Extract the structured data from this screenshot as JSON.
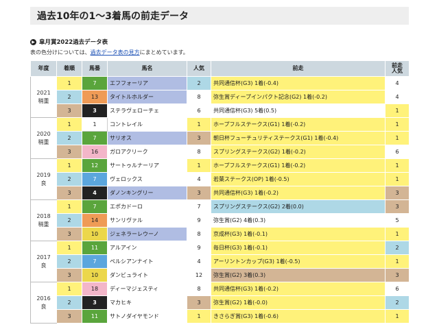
{
  "page_title": "過去10年の1〜3着馬の前走データ",
  "section_title": "皐月賞2022過去データ表",
  "note_prefix": "表の色分けについては、",
  "note_link": "過去データ表の見方",
  "note_suffix": "にまとめています。",
  "headers": {
    "year": "年度",
    "rank": "着順",
    "gate": "馬番",
    "name": "馬名",
    "pop": "人気",
    "prev": "前走",
    "prevpop_line1": "前走",
    "prevpop_line2": "人気"
  },
  "groups": [
    {
      "year": "2021",
      "track": "稍重",
      "rows": [
        {
          "rank": "1",
          "gate": "7",
          "name": "エフフォーリア",
          "pop": "2",
          "prev": "共同通信杯(G3) 1着(-0.4)",
          "prevpop": "4",
          "c": {
            "rank": "y",
            "gate": "g6",
            "name": "l",
            "pop": "b",
            "prev": "y",
            "prevpop": "w"
          }
        },
        {
          "rank": "2",
          "gate": "13",
          "name": "タイトルホルダー",
          "pop": "8",
          "prev": "弥生賞ディープインパクト記念(G2) 1着(-0.2)",
          "prevpop": "4",
          "c": {
            "rank": "b",
            "gate": "g7",
            "name": "l",
            "pop": "w",
            "prev": "y",
            "prevpop": "w"
          }
        },
        {
          "rank": "3",
          "gate": "3",
          "name": "ステラヴェローチェ",
          "pop": "6",
          "prev": "共同通信杯(G3) 5着(0.5)",
          "prevpop": "1",
          "c": {
            "rank": "t",
            "gate": "g2",
            "name": "g",
            "pop": "w",
            "prev": "w",
            "prevpop": "y"
          }
        }
      ]
    },
    {
      "year": "2020",
      "track": "稍重",
      "rows": [
        {
          "rank": "1",
          "gate": "1",
          "name": "コントレイル",
          "pop": "1",
          "prev": "ホープフルステークス(G1) 1着(-0.2)",
          "prevpop": "1",
          "c": {
            "rank": "y",
            "gate": "g1",
            "name": "g",
            "pop": "y",
            "prev": "y",
            "prevpop": "y"
          }
        },
        {
          "rank": "2",
          "gate": "7",
          "name": "サリオス",
          "pop": "3",
          "prev": "朝日杯フューチュリティステークス(G1) 1着(-0.4)",
          "prevpop": "1",
          "c": {
            "rank": "b",
            "gate": "g6",
            "name": "l",
            "pop": "t",
            "prev": "y",
            "prevpop": "y"
          }
        },
        {
          "rank": "3",
          "gate": "16",
          "name": "ガロアクリーク",
          "pop": "8",
          "prev": "スプリングステークス(G2) 1着(-0.2)",
          "prevpop": "6",
          "c": {
            "rank": "t",
            "gate": "g8",
            "name": "g",
            "pop": "w",
            "prev": "y",
            "prevpop": "w"
          }
        }
      ]
    },
    {
      "year": "2019",
      "track": "良",
      "rows": [
        {
          "rank": "1",
          "gate": "12",
          "name": "サートゥルナーリア",
          "pop": "1",
          "prev": "ホープフルステークス(G1) 1着(-0.2)",
          "prevpop": "1",
          "c": {
            "rank": "y",
            "gate": "g6",
            "name": "g",
            "pop": "y",
            "prev": "y",
            "prevpop": "y"
          }
        },
        {
          "rank": "2",
          "gate": "7",
          "name": "ヴェロックス",
          "pop": "4",
          "prev": "若葉ステークス(OP) 1着(-0.5)",
          "prevpop": "1",
          "c": {
            "rank": "b",
            "gate": "g4",
            "name": "g",
            "pop": "w",
            "prev": "y",
            "prevpop": "y"
          }
        },
        {
          "rank": "3",
          "gate": "4",
          "name": "ダノンキングリー",
          "pop": "3",
          "prev": "共同通信杯(G3) 1着(-0.2)",
          "prevpop": "3",
          "c": {
            "rank": "t",
            "gate": "g2",
            "name": "l",
            "pop": "t",
            "prev": "y",
            "prevpop": "t"
          }
        }
      ]
    },
    {
      "year": "2018",
      "track": "稍重",
      "rows": [
        {
          "rank": "1",
          "gate": "7",
          "name": "エポカドーロ",
          "pop": "7",
          "prev": "スプリングステークス(G2) 2着(0.0)",
          "prevpop": "3",
          "c": {
            "rank": "y",
            "gate": "g6",
            "name": "g",
            "pop": "w",
            "prev": "b",
            "prevpop": "t"
          }
        },
        {
          "rank": "2",
          "gate": "14",
          "name": "サンリヴァル",
          "pop": "9",
          "prev": "弥生賞(G2) 4着(0.3)",
          "prevpop": "5",
          "c": {
            "rank": "b",
            "gate": "g7",
            "name": "g",
            "pop": "w",
            "prev": "w",
            "prevpop": "w"
          }
        },
        {
          "rank": "3",
          "gate": "10",
          "name": "ジェネラーレウーノ",
          "pop": "8",
          "prev": "京成杯(G3) 1着(-0.1)",
          "prevpop": "1",
          "c": {
            "rank": "t",
            "gate": "g5",
            "name": "l",
            "pop": "w",
            "prev": "y",
            "prevpop": "y"
          }
        }
      ]
    },
    {
      "year": "2017",
      "track": "良",
      "rows": [
        {
          "rank": "1",
          "gate": "11",
          "name": "アルアイン",
          "pop": "9",
          "prev": "毎日杯(G3) 1着(-0.1)",
          "prevpop": "2",
          "c": {
            "rank": "y",
            "gate": "g6",
            "name": "g",
            "pop": "w",
            "prev": "y",
            "prevpop": "b"
          }
        },
        {
          "rank": "2",
          "gate": "7",
          "name": "ペルシアンナイト",
          "pop": "4",
          "prev": "アーリントンカップ(G3) 1着(-0.5)",
          "prevpop": "1",
          "c": {
            "rank": "b",
            "gate": "g4",
            "name": "g",
            "pop": "w",
            "prev": "y",
            "prevpop": "y"
          }
        },
        {
          "rank": "3",
          "gate": "10",
          "name": "ダンビュライト",
          "pop": "12",
          "prev": "弥生賞(G2) 3着(0.3)",
          "prevpop": "3",
          "c": {
            "rank": "t",
            "gate": "g5",
            "name": "g",
            "pop": "w",
            "prev": "t",
            "prevpop": "t"
          }
        }
      ]
    },
    {
      "year": "2016",
      "track": "良",
      "rows": [
        {
          "rank": "1",
          "gate": "18",
          "name": "ディーマジェスティ",
          "pop": "8",
          "prev": "共同通信杯(G3) 1着(-0.2)",
          "prevpop": "6",
          "c": {
            "rank": "y",
            "gate": "g8",
            "name": "g",
            "pop": "w",
            "prev": "y",
            "prevpop": "w"
          }
        },
        {
          "rank": "2",
          "gate": "3",
          "name": "マカヒキ",
          "pop": "3",
          "prev": "弥生賞(G2) 1着(-0.0)",
          "prevpop": "2",
          "c": {
            "rank": "b",
            "gate": "g2",
            "name": "g",
            "pop": "t",
            "prev": "y",
            "prevpop": "b"
          }
        },
        {
          "rank": "3",
          "gate": "11",
          "name": "サトノダイヤモンド",
          "pop": "1",
          "prev": "きさらぎ賞(G3) 1着(-0.6)",
          "prevpop": "1",
          "c": {
            "rank": "t",
            "gate": "g6",
            "name": "g",
            "pop": "y",
            "prev": "y",
            "prevpop": "y"
          }
        }
      ]
    }
  ]
}
